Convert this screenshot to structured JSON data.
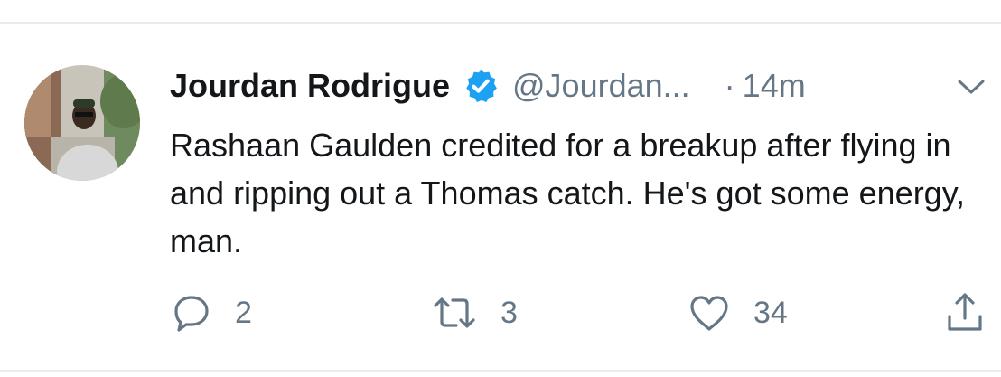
{
  "tweet": {
    "display_name": "Jourdan Rodrigue",
    "handle": "@Jourdan...",
    "separator": "·",
    "timestamp": "14m",
    "text": "Rashaan Gaulden credited for a breakup after flying in and ripping out a Thomas catch. He's got some energy, man.",
    "verified": true
  },
  "actions": {
    "reply_count": "2",
    "retweet_count": "3",
    "like_count": "34"
  },
  "colors": {
    "text": "#14171a",
    "secondary": "#657786",
    "verified_badge": "#1da1f2",
    "divider": "#e6ecf0"
  },
  "icons": {
    "avatar": "avatar",
    "verified": "verified-badge-icon",
    "menu": "chevron-down-icon",
    "reply": "reply-icon",
    "retweet": "retweet-icon",
    "like": "heart-icon",
    "share": "share-icon"
  }
}
